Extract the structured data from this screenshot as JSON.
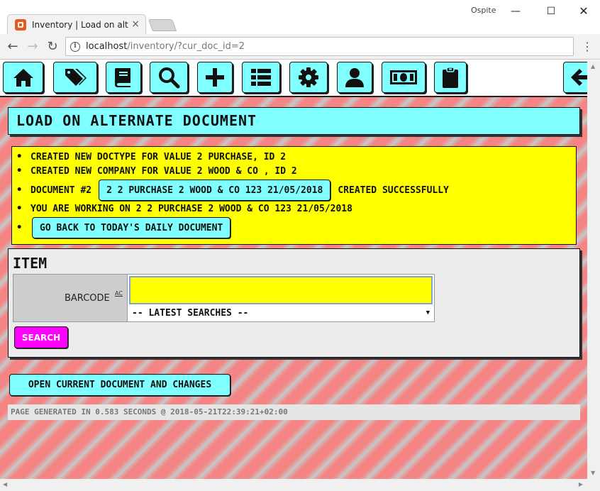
{
  "window": {
    "tab_title": "Inventory | Load on alternate document",
    "tab_close": "×",
    "user": "Ospite",
    "minimize": "—",
    "maximize": "☐",
    "close": "✕"
  },
  "browser": {
    "back": "←",
    "forward": "→",
    "reload": "↻",
    "url_host": "localhost",
    "url_path": "/inventory/?cur_doc_id=2",
    "info_icon": "i",
    "menu": "⋮"
  },
  "nav_icons": [
    "home-icon",
    "tags-icon",
    "book-icon",
    "search-icon",
    "plus-icon",
    "list-icon",
    "gear-icon",
    "user-icon",
    "money-icon",
    "clipboard-icon",
    "back-arrow-icon"
  ],
  "page": {
    "title": "LOAD ON ALTERNATE DOCUMENT",
    "messages": {
      "line1": "CREATED NEW DOCTYPE FOR VALUE 2 PURCHASE, ID 2",
      "line2": "CREATED NEW COMPANY FOR VALUE 2 WOOD & CO , ID 2",
      "line3_prefix": "DOCUMENT #2",
      "line3_link": "2 2 PURCHASE 2 WOOD & CO 123 21/05/2018",
      "line3_suffix": "CREATED SUCCESSFULLY",
      "line4": "YOU ARE WORKING ON 2 2 PURCHASE 2 WOOD & CO 123 21/05/2018",
      "line5_button": "GO BACK TO TODAY'S DAILY DOCUMENT"
    },
    "item": {
      "heading": "ITEM",
      "barcode_label": "BARCODE",
      "barcode_ac": "AC",
      "barcode_value": "",
      "latest_searches": "-- LATEST SEARCHES --",
      "search_button": "SEARCH"
    },
    "open_doc_button": "OPEN CURRENT DOCUMENT AND CHANGES",
    "footer": "PAGE GENERATED IN 0.583 SECONDS @ 2018-05-21T22:39:21+02:00"
  },
  "colors": {
    "cyan": "#7fffff",
    "yellow": "#ffff00",
    "magenta": "#ff00ff",
    "stripe_red": "#f58484",
    "stripe_gray": "#c7c7c7"
  }
}
